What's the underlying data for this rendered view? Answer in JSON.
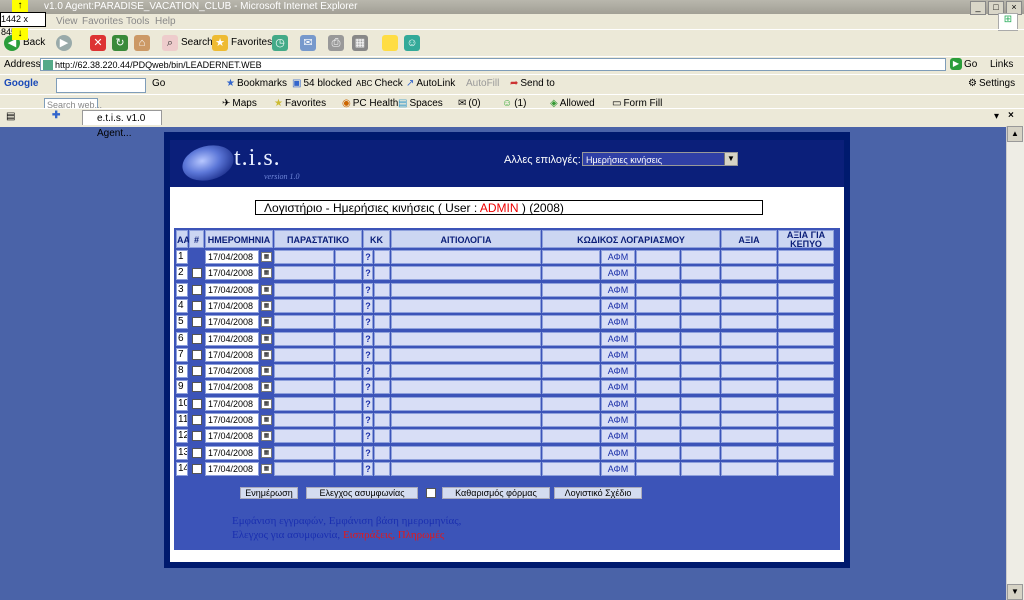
{
  "browser": {
    "window_title": "v1.0  Agent:PARADISE_VACATION_CLUB - Microsoft Internet Explorer",
    "resize_badge": "1442 x 845",
    "menu": [
      "View",
      "Favorites",
      "Tools",
      "Help"
    ],
    "toolbar": {
      "back": "Back",
      "search": "Search",
      "favorites": "Favorites"
    },
    "address_label": "Address",
    "address_value": "http://62.38.220.44/PDQweb/bin/LEADERNET.WEB",
    "go_label": "Go",
    "links_label": "Links",
    "google_bar": {
      "brand": "Google",
      "go": "Go",
      "bookmarks": "Bookmarks",
      "blocked": "54 blocked",
      "check": "Check",
      "autolink": "AutoLink",
      "autofill": "AutoFill",
      "send_to": "Send to",
      "settings": "Settings"
    },
    "third_bar": {
      "search_placeholder": "Search web...",
      "maps": "Maps",
      "favorites": "Favorites",
      "pc_health": "PC Health",
      "spaces": "Spaces",
      "count0": "(0)",
      "count1": "(1)",
      "allowed": "Allowed",
      "form_fill": "Form Fill"
    },
    "tab_label": "e.t.i.s. v1.0  Agent..."
  },
  "app": {
    "logo_text": "t.i.s.",
    "logo_version": "version 1.0",
    "options_label": "Αλλες επιλογές:",
    "options_selected": "Ημερήσιες κινήσεις",
    "title_prefix": "Λογιστήριο - Ημερήσιες κινήσεις ( User :",
    "title_user": "ADMIN",
    "title_suffix": ")",
    "title_year": "(2008)",
    "columns": [
      "ΑΑ",
      "#",
      "ΗΜΕΡΟΜΗΝΙΑ",
      "ΠΑΡΑΣΤΑΤΙΚΟ",
      "ΚΚ",
      "ΑΙΤΙΟΛΟΓΙΑ",
      "ΚΩΔΙΚΟΣ ΛΟΓΑΡΙΑΣΜΟΥ",
      "ΑΞΙΑ",
      "ΑΞΙΑ ΓΙΑ ΚΕΠΥΟ"
    ],
    "rows": [
      {
        "num": "1",
        "date": "17/04/2008",
        "kk": "?",
        "afm": "ΑΦΜ"
      },
      {
        "num": "2",
        "date": "17/04/2008",
        "kk": "?",
        "afm": "ΑΦΜ"
      },
      {
        "num": "3",
        "date": "17/04/2008",
        "kk": "?",
        "afm": "ΑΦΜ"
      },
      {
        "num": "4",
        "date": "17/04/2008",
        "kk": "?",
        "afm": "ΑΦΜ"
      },
      {
        "num": "5",
        "date": "17/04/2008",
        "kk": "?",
        "afm": "ΑΦΜ"
      },
      {
        "num": "6",
        "date": "17/04/2008",
        "kk": "?",
        "afm": "ΑΦΜ"
      },
      {
        "num": "7",
        "date": "17/04/2008",
        "kk": "?",
        "afm": "ΑΦΜ"
      },
      {
        "num": "8",
        "date": "17/04/2008",
        "kk": "?",
        "afm": "ΑΦΜ"
      },
      {
        "num": "9",
        "date": "17/04/2008",
        "kk": "?",
        "afm": "ΑΦΜ"
      },
      {
        "num": "10",
        "date": "17/04/2008",
        "kk": "?",
        "afm": "ΑΦΜ"
      },
      {
        "num": "11",
        "date": "17/04/2008",
        "kk": "?",
        "afm": "ΑΦΜ"
      },
      {
        "num": "12",
        "date": "17/04/2008",
        "kk": "?",
        "afm": "ΑΦΜ"
      },
      {
        "num": "13",
        "date": "17/04/2008",
        "kk": "?",
        "afm": "ΑΦΜ"
      },
      {
        "num": "14",
        "date": "17/04/2008",
        "kk": "?",
        "afm": "ΑΦΜ"
      }
    ],
    "buttons": {
      "update": "Ενημέρωση",
      "check": "Ελεγχος ασυμφωνίας",
      "clear": "Καθαρισμός φόρμας",
      "chart": "Λογιστικό Σχέδιο"
    },
    "links": {
      "show_entries": "Εμφάνιση εγγραφών,",
      "show_by_date": "Εμφάνιση βάση ημερομηνίας,",
      "check_mismatch": "Ελεγχος για ασυμφωνία,",
      "receipts": "Εισπράξεις,",
      "payments": "Πληρωμές"
    }
  }
}
